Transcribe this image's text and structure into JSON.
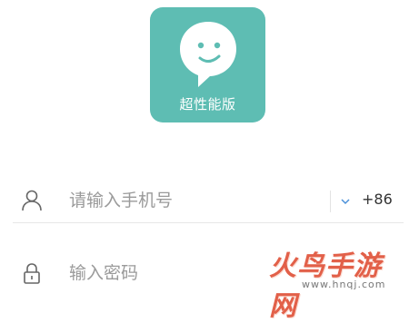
{
  "logo": {
    "caption": "超性能版",
    "tile_color": "#5ebdb3"
  },
  "phone_field": {
    "icon": "user-icon",
    "placeholder": "请输入手机号",
    "value": "",
    "country_code": "+86",
    "dropdown_icon": "chevron-down-icon"
  },
  "password_field": {
    "icon": "lock-icon",
    "placeholder": "输入密码",
    "value": ""
  },
  "watermark": {
    "title": "火鸟手游网",
    "url": "www.hnqj.com"
  }
}
